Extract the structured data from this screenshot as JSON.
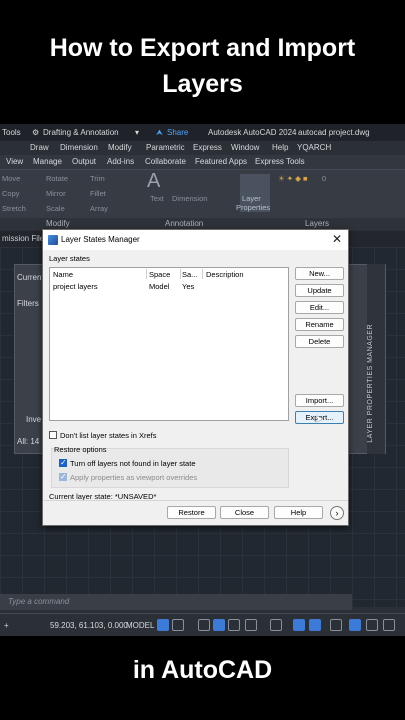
{
  "captions": {
    "top_line1": "How to Export and Import",
    "top_line2": "Layers",
    "bottom": "in AutoCAD"
  },
  "acad": {
    "title_bar": {
      "tools": "Tools",
      "workspace": "Drafting & Annotation",
      "share": "Share",
      "app": "Autodesk AutoCAD 2024",
      "file": "autocad project.dwg"
    },
    "menu": [
      "Draw",
      "Dimension",
      "Modify",
      "Parametric",
      "Express",
      "Window",
      "Help",
      "YQARCH"
    ],
    "tabs": [
      "View",
      "Manage",
      "Output",
      "Add-ins",
      "Collaborate",
      "Featured Apps",
      "Express Tools"
    ],
    "ribbon": {
      "modify": [
        "Move",
        "Rotate",
        "Trim",
        "Copy",
        "Mirror",
        "Fillet",
        "Stretch",
        "Scale",
        "Array"
      ],
      "text": "Text",
      "dimension": "Dimension",
      "layer_props_line1": "Layer",
      "layer_props_line2": "Properties",
      "layer_num": "0"
    },
    "panel_labels": {
      "modify": "Modify",
      "annotation": "Annotation",
      "layers": "Layers"
    },
    "file_tab": "mission File",
    "lpm": {
      "current": "Current",
      "filters": "Filters",
      "inve": "Inve",
      "all": "All: 14 l",
      "vertical_title": "LAYER PROPERTIES MANAGER"
    },
    "command_placeholder": "Type a command",
    "status": {
      "coords": "59.203, 61.103, 0.000",
      "model": "MODEL"
    }
  },
  "dialog": {
    "title": "Layer States Manager",
    "section_label": "Layer states",
    "columns": [
      "Name",
      "Space",
      "Sa...",
      "Description"
    ],
    "rows": [
      {
        "name": "project layers",
        "space": "Model",
        "saved": "Yes",
        "description": ""
      }
    ],
    "buttons": {
      "new": "New...",
      "update": "Update",
      "edit": "Edit...",
      "rename": "Rename",
      "delete": "Delete",
      "import": "Import...",
      "export": "Export..."
    },
    "dont_list_xrefs": {
      "label": "Don't list layer states in Xrefs",
      "checked": false
    },
    "restore_options": {
      "label": "Restore options",
      "turn_off": {
        "label": "Turn off layers not found in layer state",
        "checked": true
      },
      "apply_vp": {
        "label": "Apply properties as viewport overrides",
        "checked": true,
        "enabled": false
      }
    },
    "current_state": "Current layer state: *UNSAVED*",
    "footer": {
      "restore": "Restore",
      "close": "Close",
      "help": "Help",
      "more": "›"
    }
  }
}
